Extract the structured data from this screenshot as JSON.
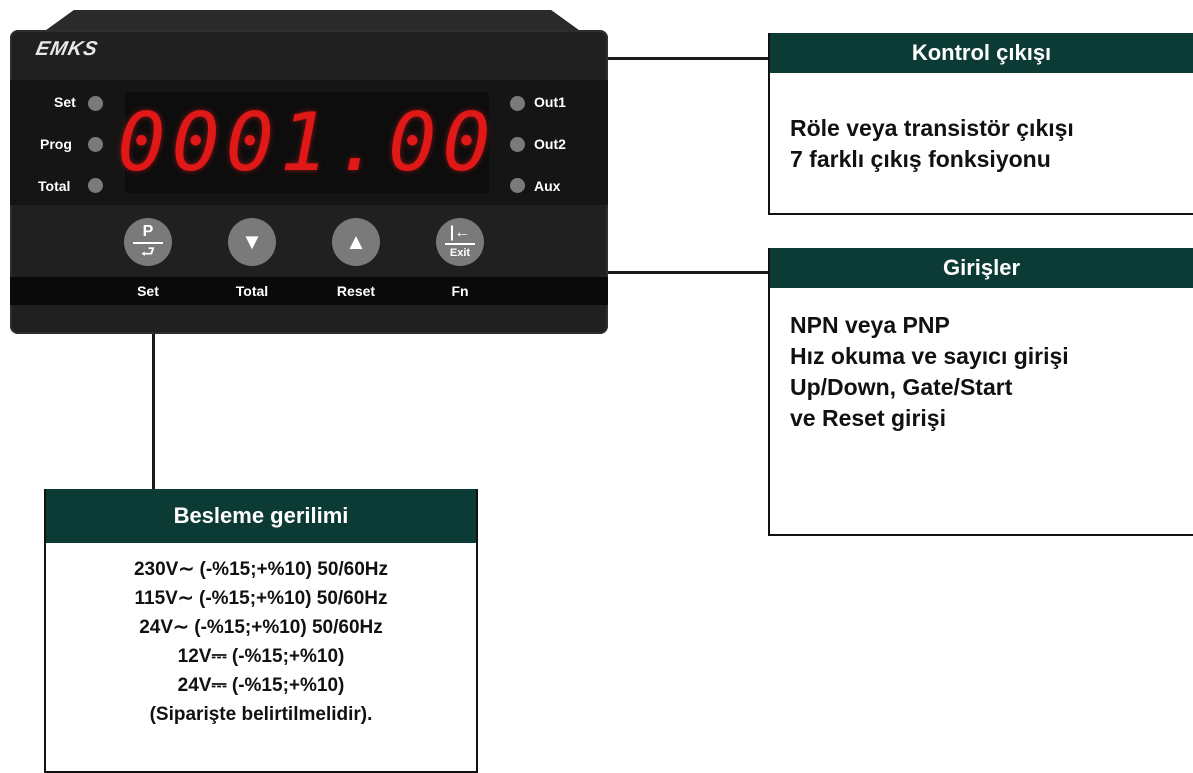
{
  "device": {
    "logo": "EMKS",
    "display_value": "0001.00",
    "left_indicators": [
      "Set",
      "Prog",
      "Total"
    ],
    "right_indicators": [
      "Out1",
      "Out2",
      "Aux"
    ],
    "buttons": [
      {
        "glyph": "P",
        "sub": "",
        "label": "Set"
      },
      {
        "glyph": "▼",
        "sub": "",
        "label": "Total"
      },
      {
        "glyph": "▲",
        "sub": "",
        "label": "Reset"
      },
      {
        "glyph": "|←",
        "sub": "Exit",
        "label": "Fn"
      }
    ]
  },
  "callouts": {
    "control_output": {
      "title": "Kontrol çıkışı",
      "lines": [
        "Röle veya transistör çıkışı",
        "7 farklı çıkış fonksiyonu"
      ]
    },
    "inputs": {
      "title": "Girişler",
      "lines": [
        "NPN veya PNP",
        "Hız okuma ve sayıcı girişi",
        "Up/Down, Gate/Start",
        "ve Reset girişi"
      ]
    },
    "supply": {
      "title": "Besleme gerilimi",
      "lines": [
        "230V∼ (-%15;+%10) 50/60Hz",
        "115V∼ (-%15;+%10) 50/60Hz",
        "24V∼ (-%15;+%10) 50/60Hz",
        "12V⎓ (-%15;+%10)",
        "24V⎓ (-%15;+%10)",
        "(Siparişte belirtilmelidir)."
      ]
    }
  },
  "colors": {
    "header_bg": "#0c3b35",
    "display_red": "#e01818",
    "device_body": "#202020"
  }
}
